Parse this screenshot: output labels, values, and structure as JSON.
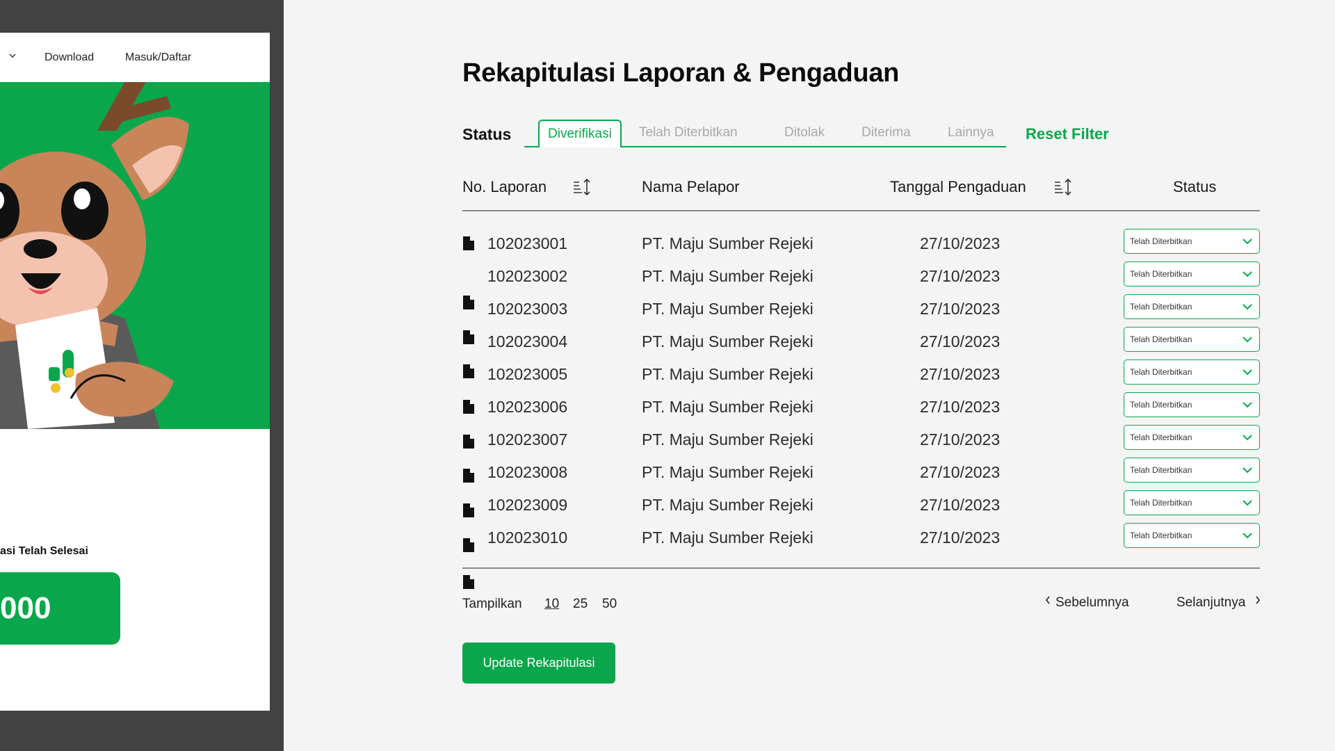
{
  "left_panel": {
    "nav": {
      "download_label": "Download",
      "login_label": "Masuk/Daftar"
    },
    "completed_label": "asi Telah Selesai",
    "counter_value": "000"
  },
  "main": {
    "title": "Rekapitulasi Laporan & Pengaduan",
    "filter": {
      "status_label": "Status",
      "tabs": [
        "Diverifikasi",
        "Telah Diterbitkan",
        "Ditolak",
        "Diterima",
        "Lainnya"
      ],
      "active_tab": "Diverifikasi",
      "reset_label": "Reset Filter"
    },
    "table": {
      "headers": {
        "no": "No. Laporan",
        "name": "Nama Pelapor",
        "date": "Tanggal Pengaduan",
        "status": "Status"
      },
      "rows": [
        {
          "no": "102023001",
          "name": "PT. Maju Sumber Rejeki",
          "date": "27/10/2023",
          "status": "Telah Diterbitkan"
        },
        {
          "no": "102023002",
          "name": "PT. Maju Sumber Rejeki",
          "date": "27/10/2023",
          "status": "Telah Diterbitkan"
        },
        {
          "no": "102023003",
          "name": "PT. Maju Sumber Rejeki",
          "date": "27/10/2023",
          "status": "Telah Diterbitkan"
        },
        {
          "no": "102023004",
          "name": "PT. Maju Sumber Rejeki",
          "date": "27/10/2023",
          "status": "Telah Diterbitkan"
        },
        {
          "no": "102023005",
          "name": "PT. Maju Sumber Rejeki",
          "date": "27/10/2023",
          "status": "Telah Diterbitkan"
        },
        {
          "no": "102023006",
          "name": "PT. Maju Sumber Rejeki",
          "date": "27/10/2023",
          "status": "Telah Diterbitkan"
        },
        {
          "no": "102023007",
          "name": "PT. Maju Sumber Rejeki",
          "date": "27/10/2023",
          "status": "Telah Diterbitkan"
        },
        {
          "no": "102023008",
          "name": "PT. Maju Sumber Rejeki",
          "date": "27/10/2023",
          "status": "Telah Diterbitkan"
        },
        {
          "no": "102023009",
          "name": "PT. Maju Sumber Rejeki",
          "date": "27/10/2023",
          "status": "Telah Diterbitkan"
        },
        {
          "no": "102023010",
          "name": "PT. Maju Sumber Rejeki",
          "date": "27/10/2023",
          "status": "Telah Diterbitkan"
        }
      ]
    },
    "pagination": {
      "show_label": "Tampilkan",
      "sizes": [
        "10",
        "25",
        "50"
      ],
      "active_size": "10",
      "prev_label": "Sebelumnya",
      "next_label": "Selanjutnya"
    },
    "update_button_label": "Update Rekapitulasi"
  },
  "colors": {
    "brand_green": "#0aa64b",
    "tab_inactive": "#a8a8a8",
    "left_frame": "#424242"
  }
}
